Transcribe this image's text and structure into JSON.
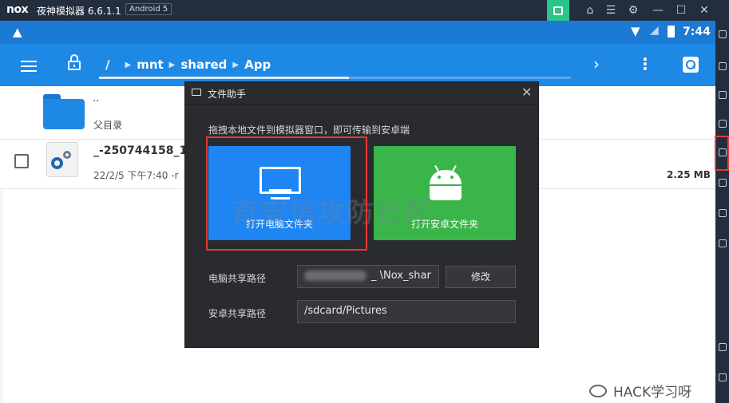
{
  "emulator": {
    "logo_text": "nox",
    "title": "夜神模拟器 6.6.1.1",
    "android_badge": "Android 5",
    "titlebar_icons": [
      "sync-icon",
      "shirt-icon",
      "menu-icon",
      "gear-icon",
      "minimize-icon",
      "maximize-icon",
      "close-icon"
    ]
  },
  "status_bar": {
    "time": "7:44"
  },
  "app_bar": {
    "root_crumb": "/",
    "crumbs": [
      "mnt",
      "shared",
      "App"
    ],
    "progress": 0.53
  },
  "file_list": {
    "parent": {
      "dots": "..",
      "label": "父目录"
    },
    "file": {
      "name": "_-250744158_1(",
      "meta": "22/2/5 下午7:40  -r",
      "size": "2.25 MB"
    }
  },
  "dialog": {
    "title": "文件助手",
    "hint": "拖拽本地文件到模拟器窗口，即可传输到安卓端",
    "open_pc_folder": "打开电脑文件夹",
    "open_android_folder": "打开安卓文件夹",
    "pc_share_label": "电脑共享路径",
    "pc_share_value": "_ \\Nox_shar",
    "modify_button": "修改",
    "android_share_label": "安卓共享路径",
    "android_share_value": "/sdcard/Pictures",
    "watermark": "奇安信攻防社区"
  },
  "watermark": {
    "text": "HACK学习呀"
  },
  "colors": {
    "status_bar": "#1c79d4",
    "app_bar": "#1e88e5",
    "dialog_bg": "#2a2b2f",
    "blue_card": "#1e85f2",
    "green_card": "#39b54a",
    "highlight": "#e53935"
  }
}
